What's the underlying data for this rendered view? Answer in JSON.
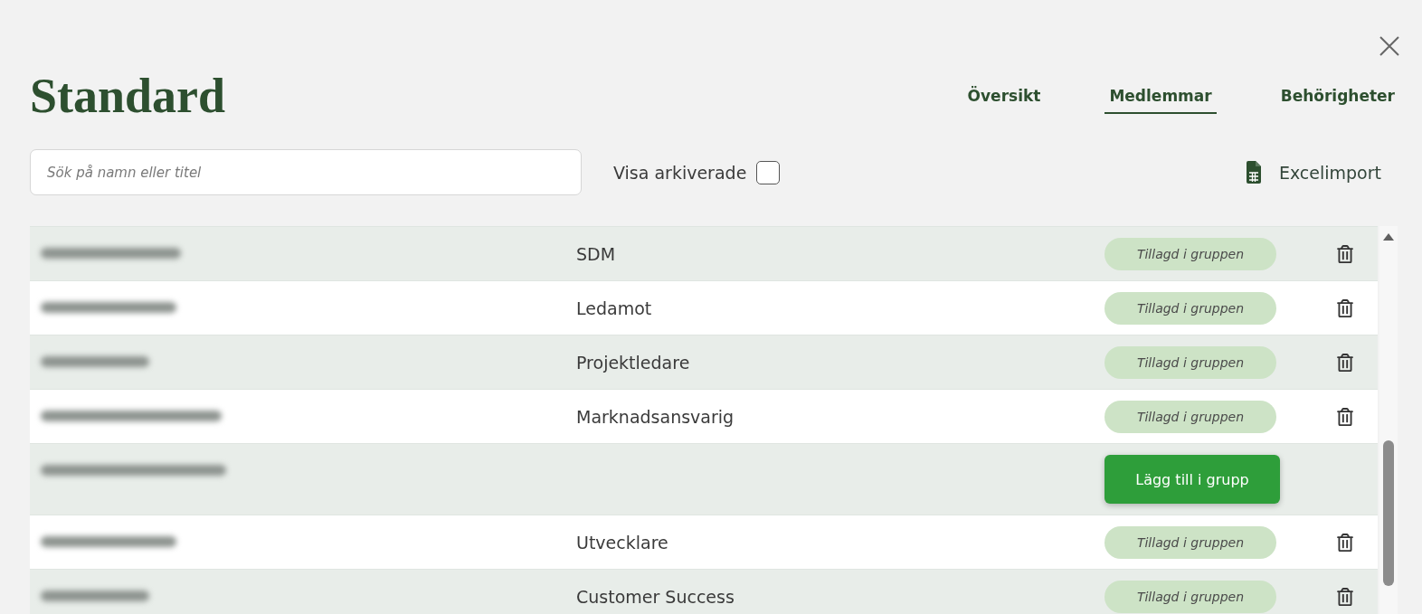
{
  "title": "Standard",
  "tabs": [
    {
      "label": "Översikt",
      "selected": false
    },
    {
      "label": "Medlemmar",
      "selected": true
    },
    {
      "label": "Behörigheter",
      "selected": false
    }
  ],
  "search": {
    "placeholder": "Sök på namn eller titel"
  },
  "show_archived": {
    "label": "Visa arkiverade",
    "checked": false
  },
  "import_button": {
    "label": "Excelimport"
  },
  "members": [
    {
      "title": "SDM",
      "status": {
        "kind": "badge",
        "label": "Tillagd i gruppen"
      }
    },
    {
      "title": "Ledamot",
      "status": {
        "kind": "badge",
        "label": "Tillagd i gruppen"
      }
    },
    {
      "title": "Projektledare",
      "status": {
        "kind": "badge",
        "label": "Tillagd i gruppen"
      }
    },
    {
      "title": "Marknadsansvarig",
      "status": {
        "kind": "badge",
        "label": "Tillagd i gruppen"
      }
    },
    {
      "status": {
        "kind": "button",
        "label": "Lägg till i grupp"
      }
    },
    {
      "title": "Utvecklare",
      "status": {
        "kind": "badge",
        "label": "Tillagd i gruppen"
      }
    },
    {
      "title": "Customer Success",
      "status": {
        "kind": "badge",
        "label": "Tillagd i gruppen"
      }
    }
  ]
}
